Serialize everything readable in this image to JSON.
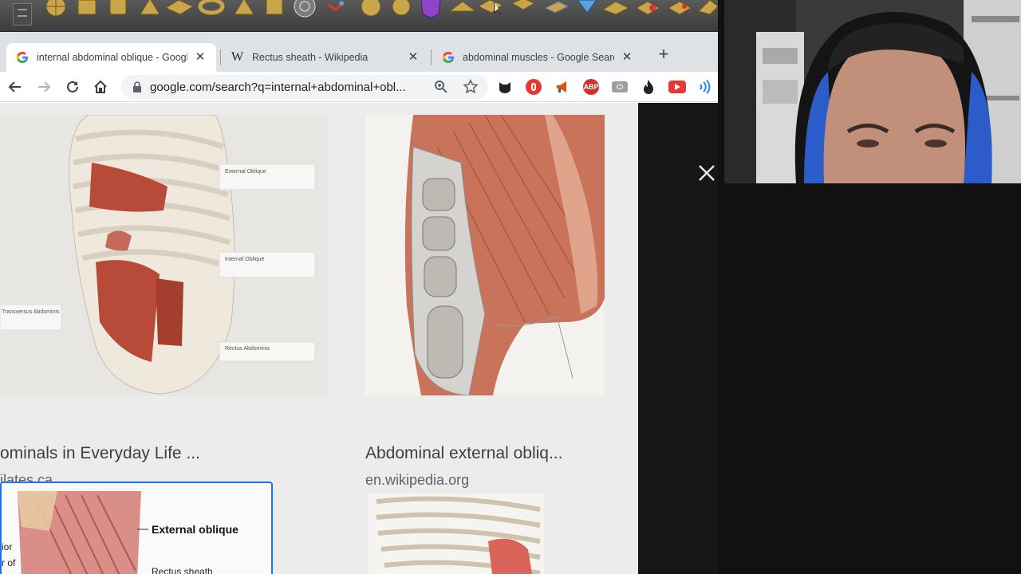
{
  "colors": {
    "tab_bar": "#dee1e6",
    "page_bg": "#ececec",
    "dark_panel": "#161616",
    "selected_outline": "#1a73e8",
    "muscle_red": "#b84a3a"
  },
  "tabs": [
    {
      "favicon": "google-icon",
      "title": "internal abdominal oblique - Google",
      "active": true
    },
    {
      "favicon": "wikipedia-icon",
      "title": "Rectus sheath - Wikipedia",
      "active": false
    },
    {
      "favicon": "google-icon",
      "title": "abdominal muscles - Google Search",
      "active": false
    }
  ],
  "omnibox": {
    "url": "google.com/search?q=internal+abdominal+obl..."
  },
  "wiki_glyph": "W",
  "extensions": {
    "adblock": "ABP"
  },
  "results": [
    {
      "title": "ominals in Everyday Life ...",
      "source": "ilates.ca",
      "labels": [
        "External Oblique",
        "Internal Oblique",
        "Rectus Abdominis",
        "Transversus Abdominis"
      ]
    },
    {
      "title": "Abdominal external obliq...",
      "source": "en.wikipedia.org"
    },
    {
      "labels": [
        "External oblique",
        "Rectus sheath",
        "ior",
        "r of"
      ]
    },
    {}
  ]
}
